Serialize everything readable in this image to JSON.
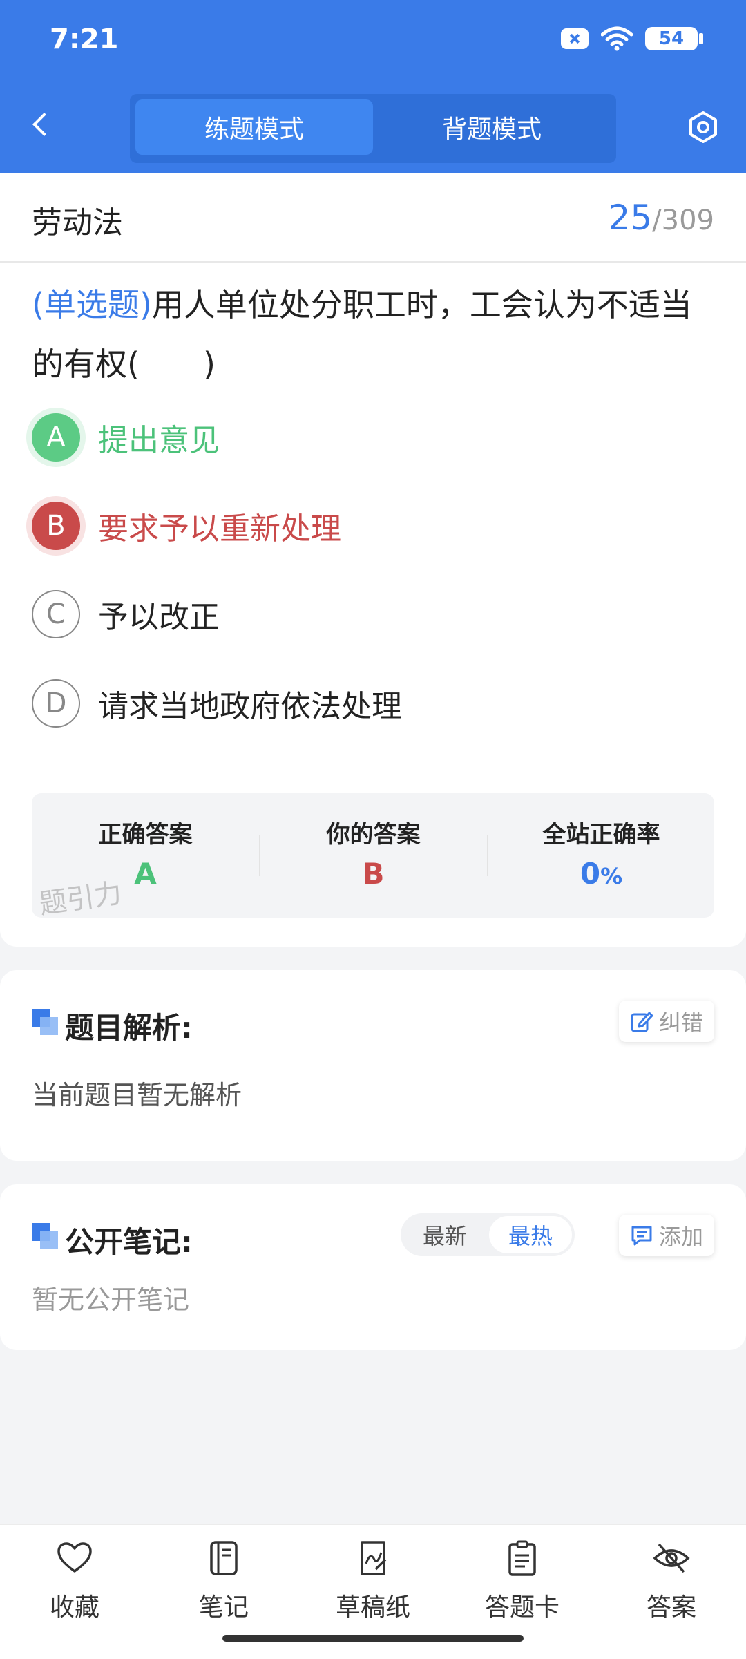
{
  "status": {
    "time": "7:21",
    "battery": "54"
  },
  "header": {
    "modes": [
      {
        "label": "练题模式",
        "active": true
      },
      {
        "label": "背题模式",
        "active": false
      }
    ]
  },
  "question": {
    "subject": "劳动法",
    "current": "25",
    "separator": "/",
    "total": "309",
    "type": "(单选题)",
    "text": "用人单位处分职工时，工会认为不适当的有权(　　)",
    "options": [
      {
        "letter": "A",
        "text": "提出意见",
        "state": "correct"
      },
      {
        "letter": "B",
        "text": "要求予以重新处理",
        "state": "wrong"
      },
      {
        "letter": "C",
        "text": "予以改正",
        "state": "normal"
      },
      {
        "letter": "D",
        "text": "请求当地政府依法处理",
        "state": "normal"
      }
    ],
    "answer": {
      "correct_label": "正确答案",
      "correct_value": "A",
      "yours_label": "你的答案",
      "yours_value": "B",
      "rate_label": "全站正确率",
      "rate_value": "0",
      "rate_unit": "%"
    },
    "watermark": "题引力"
  },
  "analysis": {
    "title": "题目解析:",
    "report_label": "纠错",
    "empty_text": "当前题目暂无解析"
  },
  "notes": {
    "title": "公开笔记:",
    "sort_latest": "最新",
    "sort_hot": "最热",
    "add_label": "添加",
    "empty_text": "暂无公开笔记"
  },
  "bottom_bar": {
    "items": [
      {
        "label": "收藏",
        "icon": "heart-icon"
      },
      {
        "label": "笔记",
        "icon": "notebook-icon"
      },
      {
        "label": "草稿纸",
        "icon": "draft-paper-icon"
      },
      {
        "label": "答题卡",
        "icon": "answer-card-icon"
      },
      {
        "label": "答案",
        "icon": "eye-off-icon"
      }
    ]
  },
  "colors": {
    "primary": "#3a7be8",
    "correct": "#4cc27a",
    "wrong": "#c94a4a"
  }
}
